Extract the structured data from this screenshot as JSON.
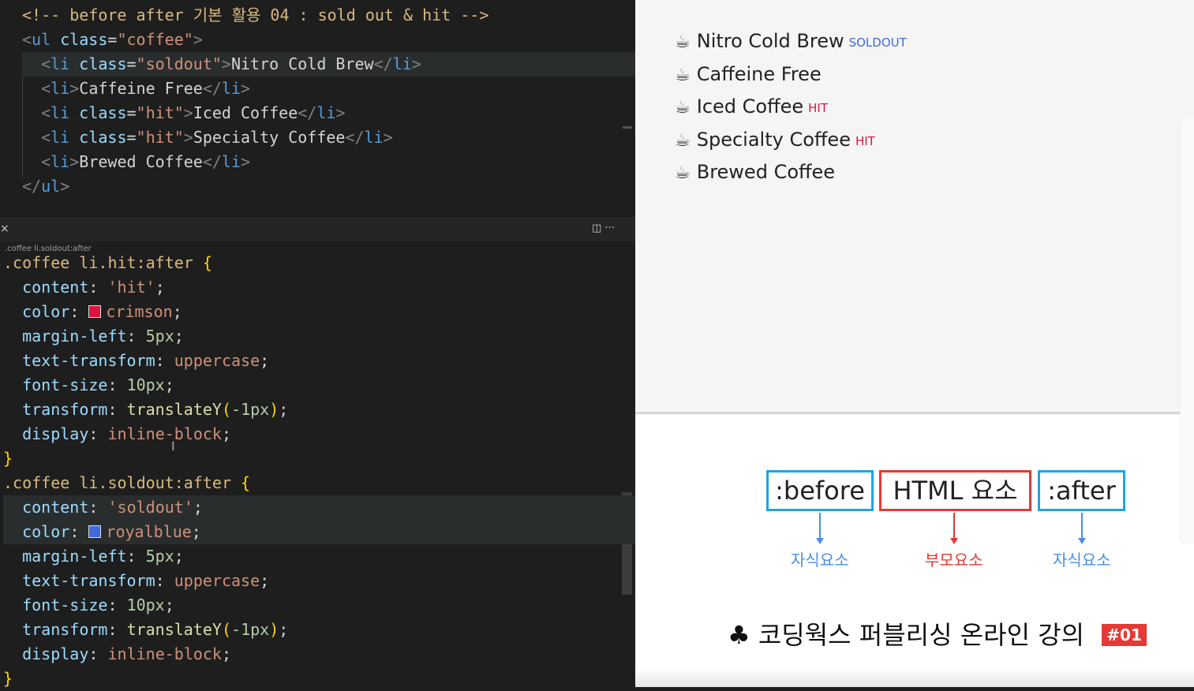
{
  "editor_top": {
    "lines": [
      {
        "parts": [
          [
            "comment",
            "<!-- before after 기본 활용 04 : sold out & hit -->"
          ]
        ]
      },
      {
        "parts": [
          [
            "bracket",
            "<"
          ],
          [
            "tag",
            "ul"
          ],
          [
            "text",
            " "
          ],
          [
            "attr",
            "class"
          ],
          [
            "text",
            "="
          ],
          [
            "str",
            "\"coffee\""
          ],
          [
            "bracket",
            ">"
          ]
        ]
      },
      {
        "parts": [
          [
            "text",
            "  "
          ],
          [
            "bracket",
            "<"
          ],
          [
            "tag",
            "li"
          ],
          [
            "text",
            " "
          ],
          [
            "attr",
            "class"
          ],
          [
            "text",
            "="
          ],
          [
            "str",
            "\"soldout\""
          ],
          [
            "bracket",
            ">"
          ],
          [
            "text",
            "Nitro Cold Brew"
          ],
          [
            "bracket",
            "</"
          ],
          [
            "tag",
            "li"
          ],
          [
            "bracket",
            ">"
          ]
        ]
      },
      {
        "parts": [
          [
            "text",
            "  "
          ],
          [
            "bracket",
            "<"
          ],
          [
            "tag",
            "li"
          ],
          [
            "bracket",
            ">"
          ],
          [
            "text",
            "Caffeine Free"
          ],
          [
            "bracket",
            "</"
          ],
          [
            "tag",
            "li"
          ],
          [
            "bracket",
            ">"
          ]
        ]
      },
      {
        "parts": [
          [
            "text",
            "  "
          ],
          [
            "bracket",
            "<"
          ],
          [
            "tag",
            "li"
          ],
          [
            "text",
            " "
          ],
          [
            "attr",
            "class"
          ],
          [
            "text",
            "="
          ],
          [
            "str",
            "\"hit\""
          ],
          [
            "bracket",
            ">"
          ],
          [
            "text",
            "Iced Coffee"
          ],
          [
            "bracket",
            "</"
          ],
          [
            "tag",
            "li"
          ],
          [
            "bracket",
            ">"
          ]
        ]
      },
      {
        "parts": [
          [
            "text",
            "  "
          ],
          [
            "bracket",
            "<"
          ],
          [
            "tag",
            "li"
          ],
          [
            "text",
            " "
          ],
          [
            "attr",
            "class"
          ],
          [
            "text",
            "="
          ],
          [
            "str",
            "\"hit\""
          ],
          [
            "bracket",
            ">"
          ],
          [
            "text",
            "Specialty Coffee"
          ],
          [
            "bracket",
            "</"
          ],
          [
            "tag",
            "li"
          ],
          [
            "bracket",
            ">"
          ]
        ]
      },
      {
        "parts": [
          [
            "text",
            "  "
          ],
          [
            "bracket",
            "<"
          ],
          [
            "tag",
            "li"
          ],
          [
            "bracket",
            ">"
          ],
          [
            "text",
            "Brewed Coffee"
          ],
          [
            "bracket",
            "</"
          ],
          [
            "tag",
            "li"
          ],
          [
            "bracket",
            ">"
          ]
        ]
      },
      {
        "parts": [
          [
            "bracket",
            "</"
          ],
          [
            "tag",
            "ul"
          ],
          [
            "bracket",
            ">"
          ]
        ]
      }
    ]
  },
  "splitter": {
    "close_glyph": "×",
    "breadcrumb": ".coffee li.soldout:after",
    "icons": "◫  ···"
  },
  "editor_bottom": {
    "lines": [
      {
        "parts": [
          [
            "sel",
            ".coffee li.hit:after "
          ],
          [
            "brace",
            "{"
          ]
        ]
      },
      {
        "parts": [
          [
            "text",
            "  "
          ],
          [
            "prop",
            "content"
          ],
          [
            "punct",
            ": "
          ],
          [
            "val",
            "'hit'"
          ],
          [
            "punct",
            ";"
          ]
        ]
      },
      {
        "parts": [
          [
            "text",
            "  "
          ],
          [
            "prop",
            "color"
          ],
          [
            "punct",
            ": "
          ],
          [
            "swatch",
            "crimson"
          ],
          [
            "val",
            "crimson"
          ],
          [
            "punct",
            ";"
          ]
        ]
      },
      {
        "parts": [
          [
            "text",
            "  "
          ],
          [
            "prop",
            "margin-left"
          ],
          [
            "punct",
            ": "
          ],
          [
            "num",
            "5px"
          ],
          [
            "punct",
            ";"
          ]
        ]
      },
      {
        "parts": [
          [
            "text",
            "  "
          ],
          [
            "prop",
            "text-transform"
          ],
          [
            "punct",
            ": "
          ],
          [
            "val",
            "uppercase"
          ],
          [
            "punct",
            ";"
          ]
        ]
      },
      {
        "parts": [
          [
            "text",
            "  "
          ],
          [
            "prop",
            "font-size"
          ],
          [
            "punct",
            ": "
          ],
          [
            "num",
            "10px"
          ],
          [
            "punct",
            ";"
          ]
        ]
      },
      {
        "parts": [
          [
            "text",
            "  "
          ],
          [
            "prop",
            "transform"
          ],
          [
            "punct",
            ": "
          ],
          [
            "fn",
            "translateY"
          ],
          [
            "brace",
            "("
          ],
          [
            "num",
            "-1px"
          ],
          [
            "brace",
            ")"
          ],
          [
            "punct",
            ";"
          ]
        ]
      },
      {
        "parts": [
          [
            "text",
            "  "
          ],
          [
            "prop",
            "display"
          ],
          [
            "punct",
            ": "
          ],
          [
            "val",
            "inline-block"
          ],
          [
            "punct",
            ";"
          ]
        ]
      },
      {
        "parts": [
          [
            "brace",
            "}"
          ]
        ]
      },
      {
        "parts": [
          [
            "sel",
            ".coffee li.soldout:after "
          ],
          [
            "brace",
            "{"
          ]
        ]
      },
      {
        "parts": [
          [
            "text",
            "  "
          ],
          [
            "prop",
            "content"
          ],
          [
            "punct",
            ": "
          ],
          [
            "val",
            "'soldout'"
          ],
          [
            "punct",
            ";"
          ]
        ]
      },
      {
        "parts": [
          [
            "text",
            "  "
          ],
          [
            "prop",
            "color"
          ],
          [
            "punct",
            ": "
          ],
          [
            "swatch",
            "royalblue"
          ],
          [
            "val",
            "royalblue"
          ],
          [
            "punct",
            ";"
          ]
        ]
      },
      {
        "parts": [
          [
            "text",
            "  "
          ],
          [
            "prop",
            "margin-left"
          ],
          [
            "punct",
            ": "
          ],
          [
            "num",
            "5px"
          ],
          [
            "punct",
            ";"
          ]
        ]
      },
      {
        "parts": [
          [
            "text",
            "  "
          ],
          [
            "prop",
            "text-transform"
          ],
          [
            "punct",
            ": "
          ],
          [
            "val",
            "uppercase"
          ],
          [
            "punct",
            ";"
          ]
        ]
      },
      {
        "parts": [
          [
            "text",
            "  "
          ],
          [
            "prop",
            "font-size"
          ],
          [
            "punct",
            ": "
          ],
          [
            "num",
            "10px"
          ],
          [
            "punct",
            ";"
          ]
        ]
      },
      {
        "parts": [
          [
            "text",
            "  "
          ],
          [
            "prop",
            "transform"
          ],
          [
            "punct",
            ": "
          ],
          [
            "fn",
            "translateY"
          ],
          [
            "brace",
            "("
          ],
          [
            "num",
            "-1px"
          ],
          [
            "brace",
            ")"
          ],
          [
            "punct",
            ";"
          ]
        ]
      },
      {
        "parts": [
          [
            "text",
            "  "
          ],
          [
            "prop",
            "display"
          ],
          [
            "punct",
            ": "
          ],
          [
            "val",
            "inline-block"
          ],
          [
            "punct",
            ";"
          ]
        ]
      },
      {
        "parts": [
          [
            "brace",
            "}"
          ]
        ]
      }
    ]
  },
  "preview": {
    "items": [
      {
        "label": "Nitro Cold Brew",
        "badge": "soldout",
        "badge_type": "soldout"
      },
      {
        "label": "Caffeine Free",
        "badge": "",
        "badge_type": ""
      },
      {
        "label": "Iced Coffee",
        "badge": "hit",
        "badge_type": "hit"
      },
      {
        "label": "Specialty Coffee",
        "badge": "hit",
        "badge_type": "hit"
      },
      {
        "label": "Brewed Coffee",
        "badge": "",
        "badge_type": ""
      }
    ],
    "icon_glyph": "☕"
  },
  "diagram": {
    "before_label": ":before",
    "html_label": "HTML 요소",
    "after_label": ":after",
    "before_caption": "자식요소",
    "html_caption": "부모요소",
    "after_caption": "자식요소"
  },
  "footer": {
    "club_glyph": "♣",
    "title": "코딩웍스 퍼블리싱 온라인 강의",
    "badge": "#01"
  },
  "colors": {
    "soldout": "#4169e1",
    "hit": "#dc143c",
    "box_blue": "#1ea5e0",
    "box_red": "#e53935"
  }
}
